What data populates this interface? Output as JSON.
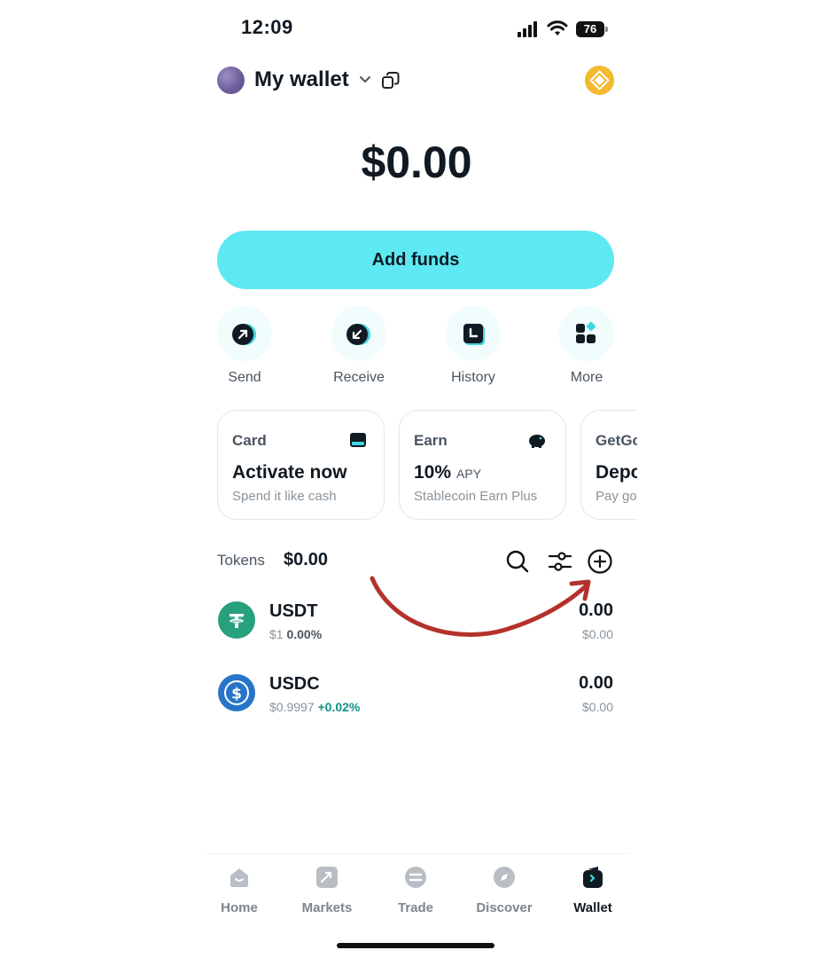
{
  "status_bar": {
    "time": "12:09",
    "battery": "76"
  },
  "header": {
    "wallet_name": "My wallet"
  },
  "balance": "$0.00",
  "add_funds_label": "Add funds",
  "quick_actions": [
    {
      "label": "Send",
      "icon": "send-icon"
    },
    {
      "label": "Receive",
      "icon": "receive-icon"
    },
    {
      "label": "History",
      "icon": "history-icon"
    },
    {
      "label": "More",
      "icon": "more-icon"
    }
  ],
  "promo_cards": [
    {
      "title": "Card",
      "headline": "Activate now",
      "subtitle": "Spend it like cash",
      "icon": "card-icon"
    },
    {
      "title": "Earn",
      "headline": "10%",
      "headline_suffix": "APY",
      "subtitle": "Stablecoin Earn Plus",
      "icon": "piggy-bank-icon"
    },
    {
      "title": "GetGo",
      "headline": "Deposit",
      "subtitle": "Pay go"
    }
  ],
  "tokens_section": {
    "label": "Tokens",
    "total": "$0.00"
  },
  "tokens": [
    {
      "symbol": "USDT",
      "price": "$1",
      "change": "0.00%",
      "amount": "0.00",
      "fiat": "$0.00",
      "color": "#26a17b"
    },
    {
      "symbol": "USDC",
      "price": "$0.9997",
      "change": "+0.02%",
      "amount": "0.00",
      "fiat": "$0.00",
      "color": "#2775ca"
    }
  ],
  "bottom_nav": [
    {
      "label": "Home",
      "icon": "home-icon"
    },
    {
      "label": "Markets",
      "icon": "markets-icon"
    },
    {
      "label": "Trade",
      "icon": "trade-icon"
    },
    {
      "label": "Discover",
      "icon": "discover-icon"
    },
    {
      "label": "Wallet",
      "icon": "wallet-icon",
      "active": true
    }
  ],
  "colors": {
    "accent": "#5ee8f2",
    "positive": "#12918a",
    "annotation": "#b3322b",
    "bnb": "#f3ba2f"
  }
}
